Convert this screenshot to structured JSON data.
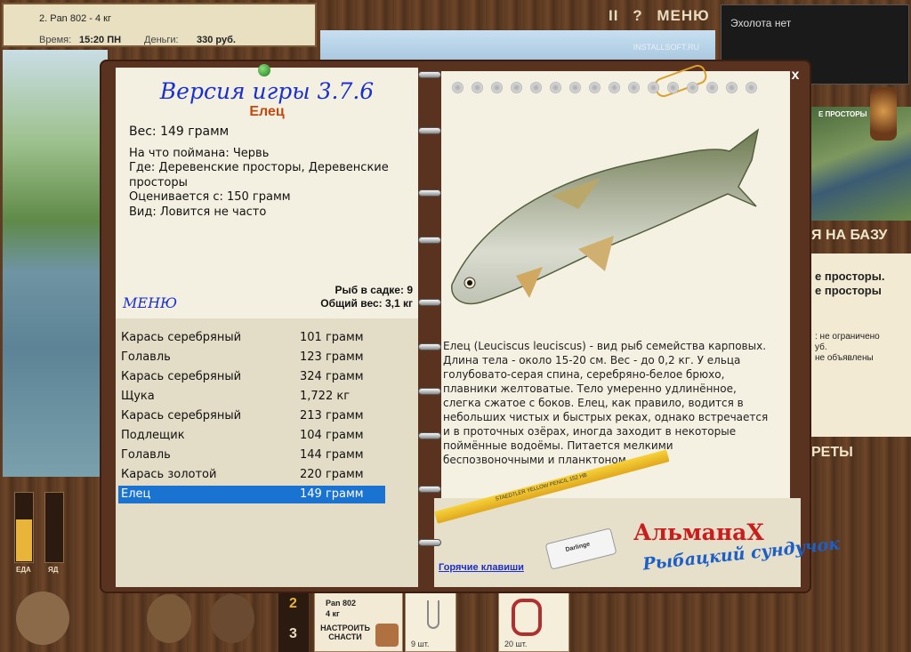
{
  "status": {
    "rod": "2. Pan 802 - 4 кг",
    "time_label": "Время:",
    "time_value": "15:20 ПН",
    "money_label": "Деньги:",
    "money_value": "330 руб."
  },
  "topbar": {
    "pause": "II",
    "help": "?",
    "menu": "МЕНЮ"
  },
  "echo": {
    "text": "Эхолота нет"
  },
  "watermark": "INSTALLSOFT.RU",
  "right_side": {
    "map_caption": "Е ПРОСТОРЫ",
    "base": "Я НА БАЗУ",
    "place_lines": "е просторы.\nе просторы",
    "limit_text": ": не ограничено\nуб.\nне объявлены",
    "secrets": "РЕТЫ"
  },
  "gauges": {
    "food": "ЕДА",
    "poison": "ЯД",
    "food_level": 0.62,
    "poison_level": 0.0
  },
  "book": {
    "version": "Версия игры 3.7.6",
    "fish_name": "Елец",
    "weight": "Вес: 149 грамм",
    "bait": "На что поймана: Червь",
    "where": "Где: Деревенские просторы, Деревенские просторы",
    "valued": "Оценивается с: 150 грамм",
    "kind": "Вид: Ловится не часто",
    "menu": "МЕНЮ",
    "cage_count": "Рыб в садке: 9",
    "cage_weight": "Общий вес: 3,1 кг",
    "description": "Елец (Leuciscus leuciscus) - вид рыб семейства карповых. Длина тела - около 15-20 см. Вес - до 0,2 кг. У ельца голубовато-серая спина, серебряно-белое брюхо, плавники желтоватые. Тело умеренно удлинённое, слегка сжатое с боков. Елец, как правило, водится в небольших чистых и быстрых реках, однако встречается и в проточных озёрах, иногда заходит в некоторые поймённые водоёмы. Питается мелкими беспозвоночными и планктоном.",
    "hotkeys": "Горячие клавиши",
    "brand_top": "АльманаХ",
    "brand_bottom": "Рыбацкий сундучок",
    "pencil_text": "STAEDTLER YELLOW PENCIL 152 HB",
    "eraser_text": "Darlinge",
    "close": "x"
  },
  "catch_list": [
    {
      "name": "Карась серебряный",
      "weight": "101 грамм"
    },
    {
      "name": "Голавль",
      "weight": "123 грамм"
    },
    {
      "name": "Карась серебряный",
      "weight": "324 грамм"
    },
    {
      "name": "Щука",
      "weight": "1,722 кг"
    },
    {
      "name": "Карась серебряный",
      "weight": "213 грамм"
    },
    {
      "name": "Подлещик",
      "weight": "104 грамм"
    },
    {
      "name": "Голавль",
      "weight": "144 грамм"
    },
    {
      "name": "Карась золотой",
      "weight": "220 грамм"
    },
    {
      "name": "Елец",
      "weight": "149 грамм"
    }
  ],
  "bottom": {
    "slot2": "2",
    "slot3": "3",
    "rod_name": "Pan 802",
    "rod_weight": "4 кг",
    "setup": "НАСТРОИТЬ СНАСТИ",
    "hook_count": "9 шт.",
    "worm_count": "20 шт."
  }
}
